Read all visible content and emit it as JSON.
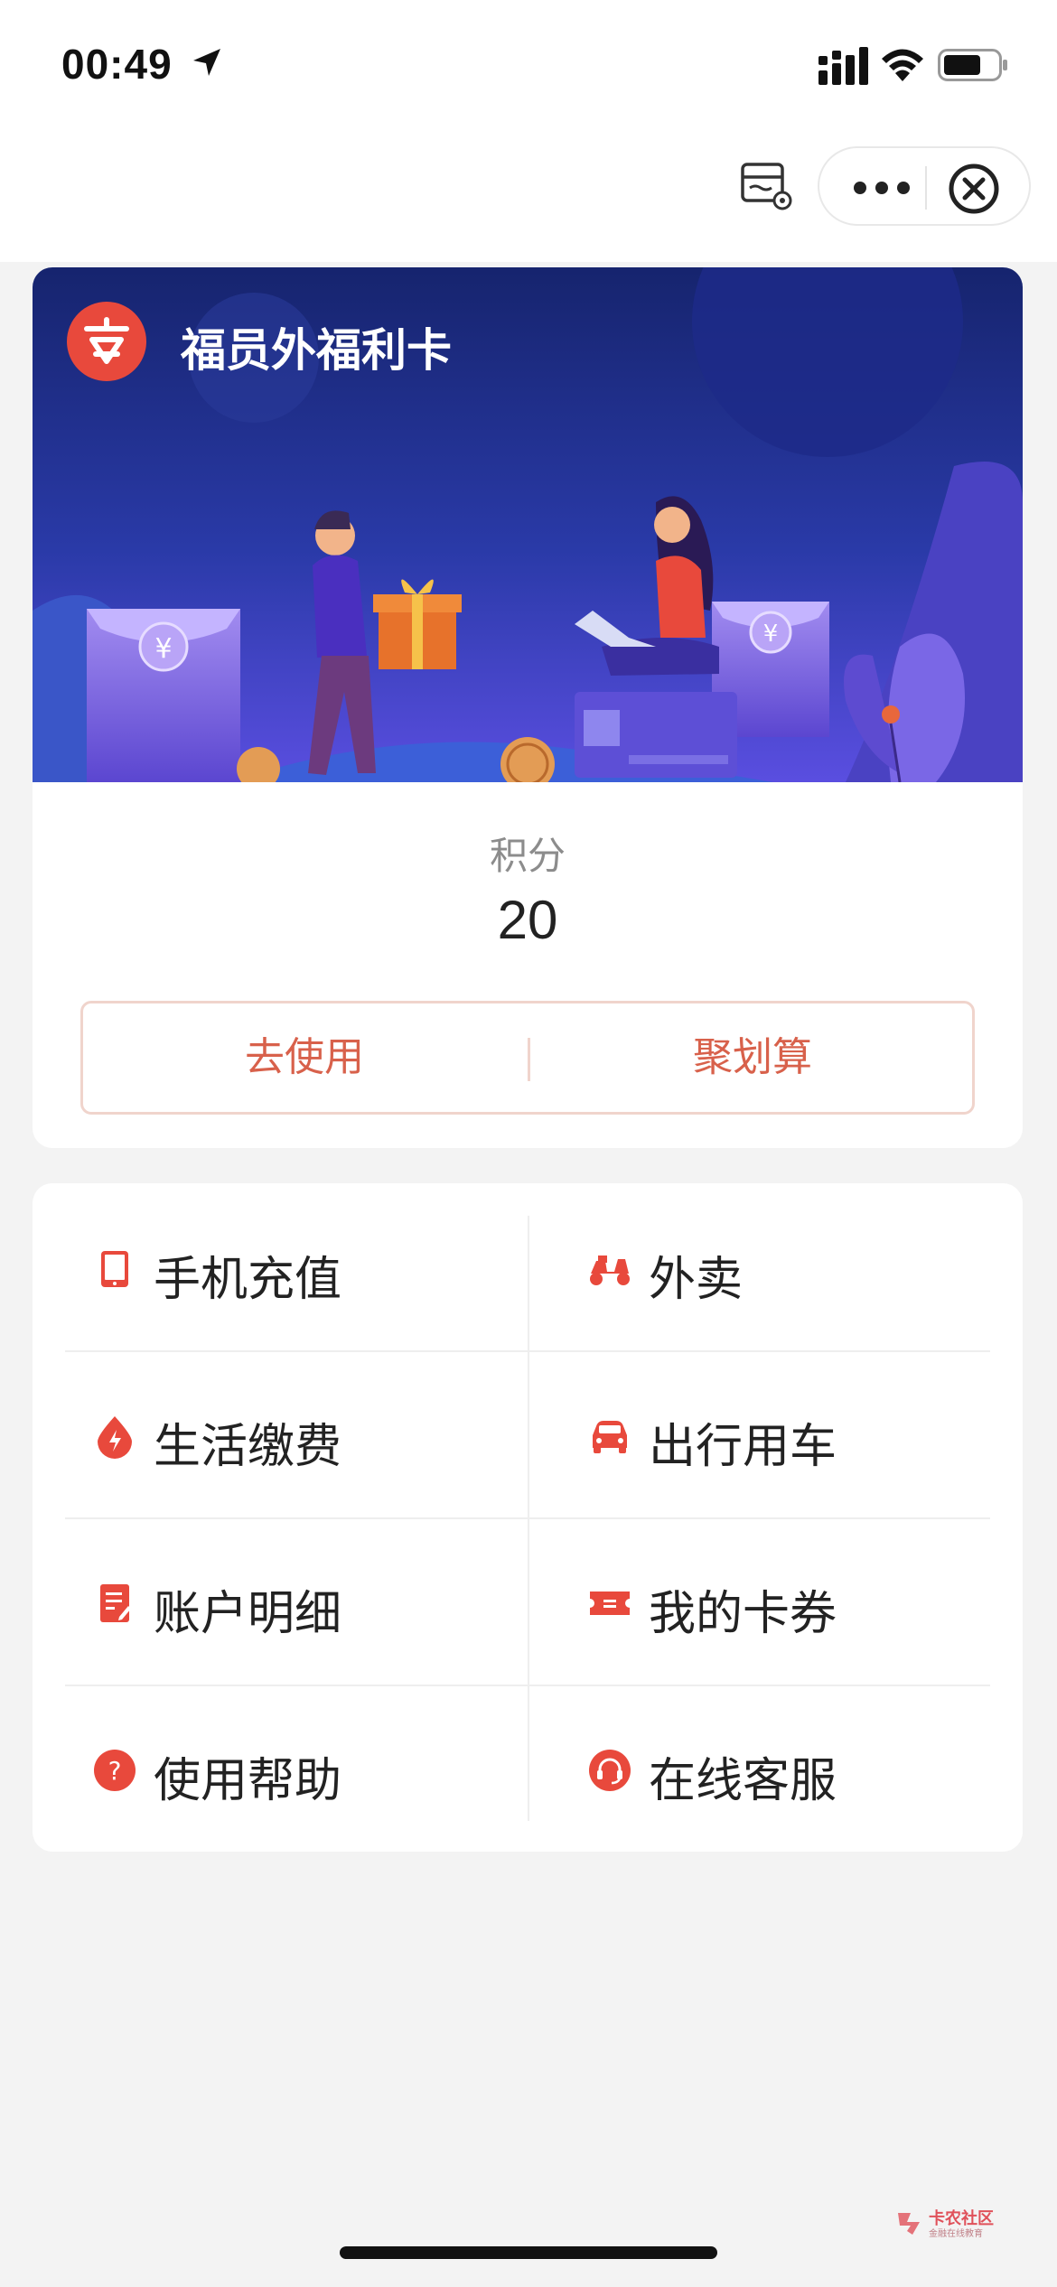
{
  "status_bar": {
    "time": "00:49"
  },
  "card": {
    "title": "福员外福利卡",
    "points_label": "积分",
    "points_value": "20",
    "actions": {
      "use": "去使用",
      "deal": "聚划算"
    }
  },
  "menu": {
    "items": [
      {
        "label": "手机充值",
        "icon": "phone-icon"
      },
      {
        "label": "外卖",
        "icon": "scooter-icon"
      },
      {
        "label": "生活缴费",
        "icon": "utility-drop-icon"
      },
      {
        "label": "出行用车",
        "icon": "car-icon"
      },
      {
        "label": "账户明细",
        "icon": "document-icon"
      },
      {
        "label": "我的卡券",
        "icon": "ticket-icon"
      },
      {
        "label": "使用帮助",
        "icon": "help-icon"
      },
      {
        "label": "在线客服",
        "icon": "headset-icon"
      }
    ]
  },
  "watermark": {
    "title": "卡农社区",
    "subtitle": "金融在线教育"
  },
  "colors": {
    "accent": "#e8493c",
    "action_text": "#d8614b",
    "banner_dark": "#1a2a78",
    "banner_light": "#5b4bd6"
  }
}
